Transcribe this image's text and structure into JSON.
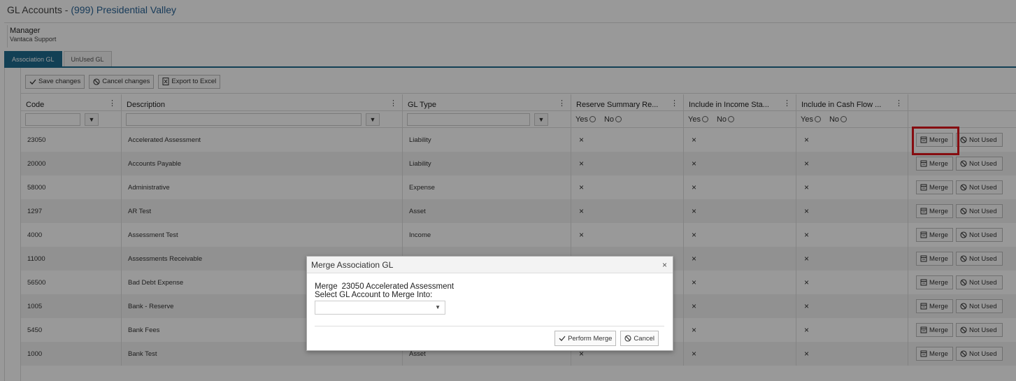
{
  "header": {
    "title_prefix": "GL Accounts - ",
    "association": "(999) Presidential Valley"
  },
  "manager": {
    "label": "Manager",
    "value": "Vantaca Support"
  },
  "tabs": [
    {
      "label": "Association GL",
      "active": true
    },
    {
      "label": "UnUsed GL",
      "active": false
    }
  ],
  "toolbar": {
    "save_label": "Save changes",
    "cancel_label": "Cancel changes",
    "export_label": "Export to Excel"
  },
  "columns": [
    "Code",
    "Description",
    "GL Type",
    "Reserve Summary Re...",
    "Include in Income Sta...",
    "Include in Cash Flow ..."
  ],
  "filters": {
    "yes_label": "Yes",
    "no_label": "No"
  },
  "row_actions": {
    "merge_label": "Merge",
    "not_used_label": "Not Used"
  },
  "rows": [
    {
      "code": "23050",
      "description": "Accelerated Assessment",
      "gl_type": "Liability"
    },
    {
      "code": "20000",
      "description": "Accounts Payable",
      "gl_type": "Liability"
    },
    {
      "code": "58000",
      "description": "Administrative",
      "gl_type": "Expense"
    },
    {
      "code": "1297",
      "description": "AR Test",
      "gl_type": "Asset"
    },
    {
      "code": "4000",
      "description": "Assessment Test",
      "gl_type": "Income"
    },
    {
      "code": "11000",
      "description": "Assessments Receivable",
      "gl_type": ""
    },
    {
      "code": "56500",
      "description": "Bad Debt Expense",
      "gl_type": ""
    },
    {
      "code": "1005",
      "description": "Bank - Reserve",
      "gl_type": ""
    },
    {
      "code": "5450",
      "description": "Bank Fees",
      "gl_type": ""
    },
    {
      "code": "1000",
      "description": "Bank Test",
      "gl_type": "Asset"
    }
  ],
  "x_mark": "×",
  "dialog": {
    "title": "Merge Association GL",
    "merge_label": "Merge",
    "merge_account": "23050 Accelerated Assessment",
    "select_label": "Select GL Account to Merge Into:",
    "select_value": "",
    "perform_label": "Perform Merge",
    "cancel_label": "Cancel"
  }
}
